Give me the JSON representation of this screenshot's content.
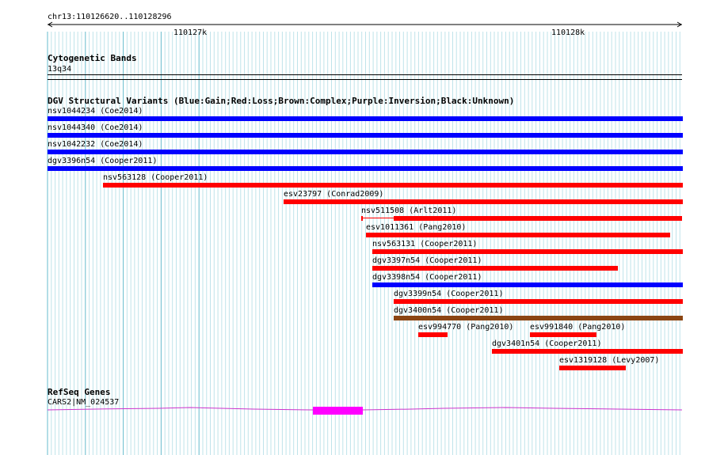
{
  "ruler": {
    "location": "chr13:110126620..110128296",
    "tick_labels": [
      "110127k",
      "110128k"
    ]
  },
  "cytoband": {
    "title": "Cytogenetic Bands",
    "band": "13q34"
  },
  "dgv": {
    "title": "DGV Structural Variants (Blue:Gain;Red:Loss;Brown:Complex;Purple:Inversion;Black:Unknown)",
    "colors": {
      "gain": "#0000ff",
      "loss": "#ff0000",
      "complex": "#8b4513"
    },
    "features": [
      {
        "label": "nsv1044234 (Coe2014)",
        "type": "gain"
      },
      {
        "label": "nsv1044340 (Coe2014)",
        "type": "gain"
      },
      {
        "label": "nsv1042232 (Coe2014)",
        "type": "gain"
      },
      {
        "label": "dgv3396n54 (Cooper2011)",
        "type": "gain"
      },
      {
        "label": "nsv563128 (Cooper2011)",
        "type": "loss"
      },
      {
        "label": "esv23797 (Conrad2009)",
        "type": "loss"
      },
      {
        "label": "nsv511508 (Arlt2011)",
        "type": "loss"
      },
      {
        "label": "esv1011361 (Pang2010)",
        "type": "loss"
      },
      {
        "label": "nsv563131 (Cooper2011)",
        "type": "loss"
      },
      {
        "label": "dgv3397n54 (Cooper2011)",
        "type": "loss"
      },
      {
        "label": "dgv3398n54 (Cooper2011)",
        "type": "gain"
      },
      {
        "label": "dgv3399n54 (Cooper2011)",
        "type": "loss"
      },
      {
        "label": "dgv3400n54 (Cooper2011)",
        "type": "complex"
      },
      {
        "label": "esv994770 (Pang2010)",
        "type": "loss"
      },
      {
        "label": "esv991840 (Pang2010)",
        "type": "loss"
      },
      {
        "label": "dgv3401n54 (Cooper2011)",
        "type": "loss"
      },
      {
        "label": "esv1319128 (Levy2007)",
        "type": "loss"
      }
    ]
  },
  "refseq": {
    "title": "RefSeq Genes",
    "gene_label": "CARS2|NM_024537",
    "color": "#ff00ff"
  }
}
